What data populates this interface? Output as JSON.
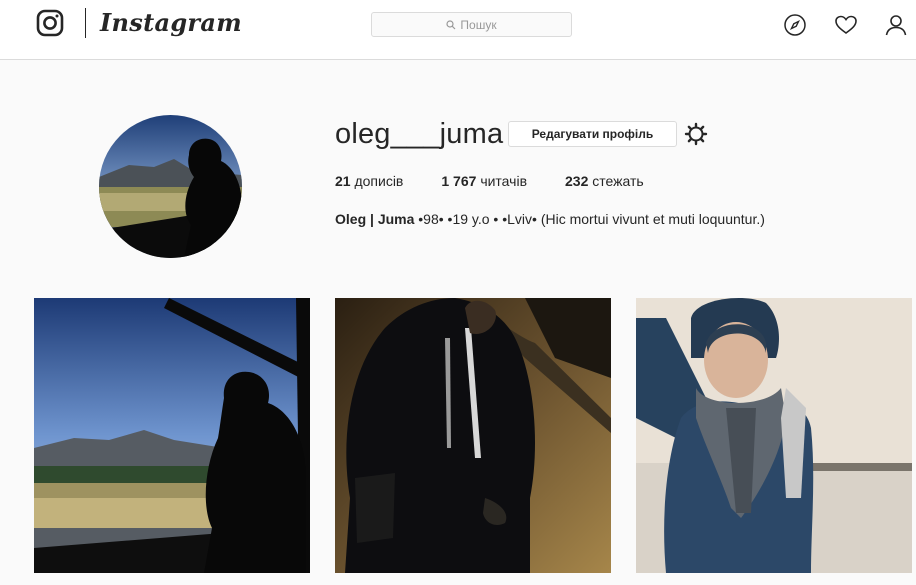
{
  "header": {
    "logo_icon": "instagram-camera-icon",
    "wordmark": "Instagram",
    "search": {
      "placeholder": "Пошук",
      "icon": "search-icon"
    },
    "nav_icons": [
      "compass-icon",
      "heart-icon",
      "person-icon"
    ]
  },
  "profile": {
    "username": "oleg___juma",
    "edit_button": "Редагувати профіль",
    "settings_icon": "gear-icon",
    "stats": {
      "posts_count": "21",
      "posts_label": "дописів",
      "followers_count": "1 767",
      "followers_label": "читачів",
      "following_count": "232",
      "following_label": "стежать"
    },
    "bio_name": "Oleg | Juma",
    "bio_text": " •98• •19 y.o • •Lviv• (Hic mortui vivunt et muti loquuntur.)"
  },
  "posts": [
    {
      "subject": "silhouette-mountains-photo"
    },
    {
      "subject": "night-road-photo"
    },
    {
      "subject": "portrait-scarf-photo"
    }
  ],
  "colors": {
    "background": "#fafafa",
    "header_bg": "#ffffff",
    "border": "#dbdbdb",
    "text": "#262626"
  }
}
